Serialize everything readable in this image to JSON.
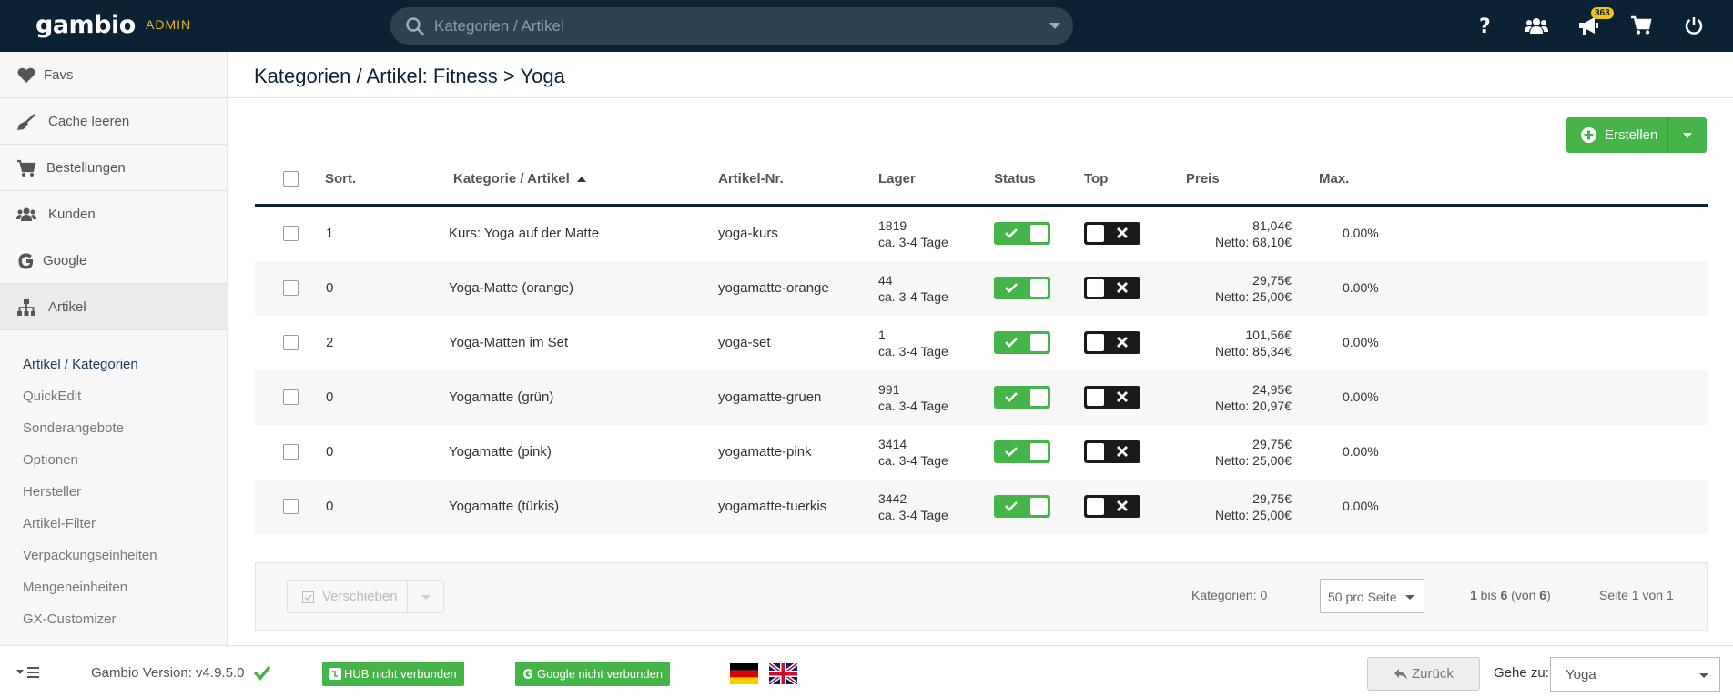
{
  "header": {
    "logo": "gambio",
    "logo_suffix": "ADMIN",
    "search_placeholder": "Kategorien / Artikel",
    "notification_count": "363",
    "icons": [
      "help-icon",
      "customers-icon",
      "megaphone-icon",
      "cart-icon",
      "power-icon"
    ]
  },
  "sidebar": {
    "items": [
      {
        "label": "Favs",
        "icon": "heart-icon"
      },
      {
        "label": "Cache leeren",
        "icon": "broom-icon"
      },
      {
        "label": "Bestellungen",
        "icon": "cart-icon"
      },
      {
        "label": "Kunden",
        "icon": "users-icon"
      },
      {
        "label": "Google",
        "icon": "google-icon"
      },
      {
        "label": "Artikel",
        "icon": "sitemap-icon"
      }
    ],
    "subitems": [
      "Artikel / Kategorien",
      "QuickEdit",
      "Sonderangebote",
      "Optionen",
      "Hersteller",
      "Artikel-Filter",
      "Verpackungseinheiten",
      "Mengeneinheiten",
      "GX-Customizer"
    ]
  },
  "page": {
    "title": "Kategorien / Artikel: Fitness > Yoga",
    "create_label": "Erstellen"
  },
  "table": {
    "headers": {
      "sort": "Sort.",
      "name": "Kategorie / Artikel",
      "sku": "Artikel-Nr.",
      "stock": "Lager",
      "status": "Status",
      "top": "Top",
      "price": "Preis",
      "max": "Max."
    },
    "rows": [
      {
        "sort": "1",
        "name": "Kurs: Yoga auf der Matte",
        "sku": "yoga-kurs",
        "stock": "1819",
        "delivery": "ca. 3-4 Tage",
        "status": true,
        "top": false,
        "price": "81,04€",
        "net": "Netto: 68,10€",
        "max": "0.00%"
      },
      {
        "sort": "0",
        "name": "Yoga-Matte (orange)",
        "sku": "yogamatte-orange",
        "stock": "44",
        "delivery": "ca. 3-4 Tage",
        "status": true,
        "top": false,
        "price": "29,75€",
        "net": "Netto: 25,00€",
        "max": "0.00%"
      },
      {
        "sort": "2",
        "name": "Yoga-Matten im Set",
        "sku": "yoga-set",
        "stock": "1",
        "delivery": "ca. 3-4 Tage",
        "status": true,
        "top": false,
        "price": "101,56€",
        "net": "Netto: 85,34€",
        "max": "0.00%"
      },
      {
        "sort": "0",
        "name": "Yogamatte (grün)",
        "sku": "yogamatte-gruen",
        "stock": "991",
        "delivery": "ca. 3-4 Tage",
        "status": true,
        "top": false,
        "price": "24,95€",
        "net": "Netto: 20,97€",
        "max": "0.00%"
      },
      {
        "sort": "0",
        "name": "Yogamatte (pink)",
        "sku": "yogamatte-pink",
        "stock": "3414",
        "delivery": "ca. 3-4 Tage",
        "status": true,
        "top": false,
        "price": "29,75€",
        "net": "Netto: 25,00€",
        "max": "0.00%"
      },
      {
        "sort": "0",
        "name": "Yogamatte (türkis)",
        "sku": "yogamatte-tuerkis",
        "stock": "3442",
        "delivery": "ca. 3-4 Tage",
        "status": true,
        "top": false,
        "price": "29,75€",
        "net": "Netto: 25,00€",
        "max": "0.00%"
      }
    ]
  },
  "pagination": {
    "move_label": "Verschieben",
    "categories_count": "Kategorien: 0",
    "per_page": "50 pro Seite",
    "range_prefix": "1",
    "range_mid": " bis ",
    "range_to": "6",
    "range_open": " (von ",
    "range_total": "6",
    "range_close": ")",
    "page_info": "Seite 1 von 1"
  },
  "footer": {
    "version": "Gambio Version: v4.9.5.0",
    "hub_label": "HUB nicht verbunden",
    "google_label": "Google nicht verbunden",
    "back_label": "Zurück",
    "goto_label": "Gehe zu:",
    "goto_value": "Yoga"
  },
  "colors": {
    "topbar": "#0b2235",
    "accent_green": "#45b549",
    "admin_gold": "#e8b923"
  }
}
